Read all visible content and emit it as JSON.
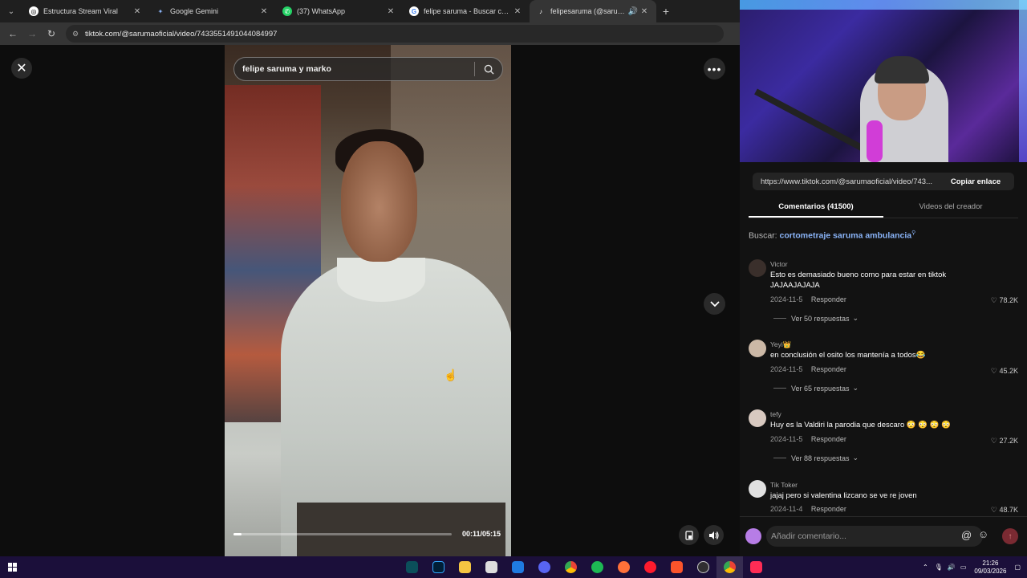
{
  "browser": {
    "tabs": [
      {
        "label": "Estructura Stream Viral",
        "favicon": "openai-icon",
        "active": false
      },
      {
        "label": "Google Gemini",
        "favicon": "gemini-icon",
        "active": false
      },
      {
        "label": "(37) WhatsApp",
        "favicon": "whatsapp-icon",
        "active": false
      },
      {
        "label": "felipe saruma - Buscar con Goo",
        "favicon": "google-icon",
        "active": false
      },
      {
        "label": "felipesaruma (@sarumaofic",
        "favicon": "tiktok-icon",
        "active": true
      }
    ],
    "url": "tiktok.com/@sarumaoficial/video/7433551491044084997"
  },
  "viewer": {
    "search_query": "felipe saruma y marko",
    "progress": 0.035,
    "timecode": "00:11/05:15"
  },
  "panel": {
    "share_url": "https://www.tiktok.com/@sarumaoficial/video/743...",
    "copy_label": "Copiar enlace",
    "tabs": {
      "comments": "Comentarios (41500)",
      "creator_videos": "Videos del creador"
    },
    "search_prefix": "Buscar:",
    "search_suggestion": "cortometraje saruma ambulancia",
    "comments": [
      {
        "user": "Victor",
        "text": "Esto es demasiado bueno como para estar en tiktok JAJAAJAJAJA",
        "date": "2024-11-5",
        "reply": "Responder",
        "likes": "78.2K",
        "more": "Ver 50 respuestas"
      },
      {
        "user": "Yeyi👑",
        "text": "en conclusión el osito los mantenía a todos😂",
        "date": "2024-11-5",
        "reply": "Responder",
        "likes": "45.2K",
        "more": "Ver 65 respuestas"
      },
      {
        "user": "tefy",
        "text": "Huy es la Valdiri la parodia que descaro 😳 😳 😳 😳",
        "date": "2024-11-5",
        "reply": "Responder",
        "likes": "27.2K",
        "more": "Ver 88 respuestas"
      },
      {
        "user": "Tik Toker",
        "text": "jajaj pero si valentina lizcano se ve re joven",
        "date": "2024-11-4",
        "reply": "Responder",
        "likes": "48.7K",
        "more": ""
      }
    ],
    "composer_placeholder": "Añadir comentario..."
  },
  "taskbar": {
    "time": "21:26",
    "date": "09/03/2026"
  },
  "colors": {
    "accent_link": "#8ab4f8",
    "taskbar": "#1b0f3a"
  }
}
